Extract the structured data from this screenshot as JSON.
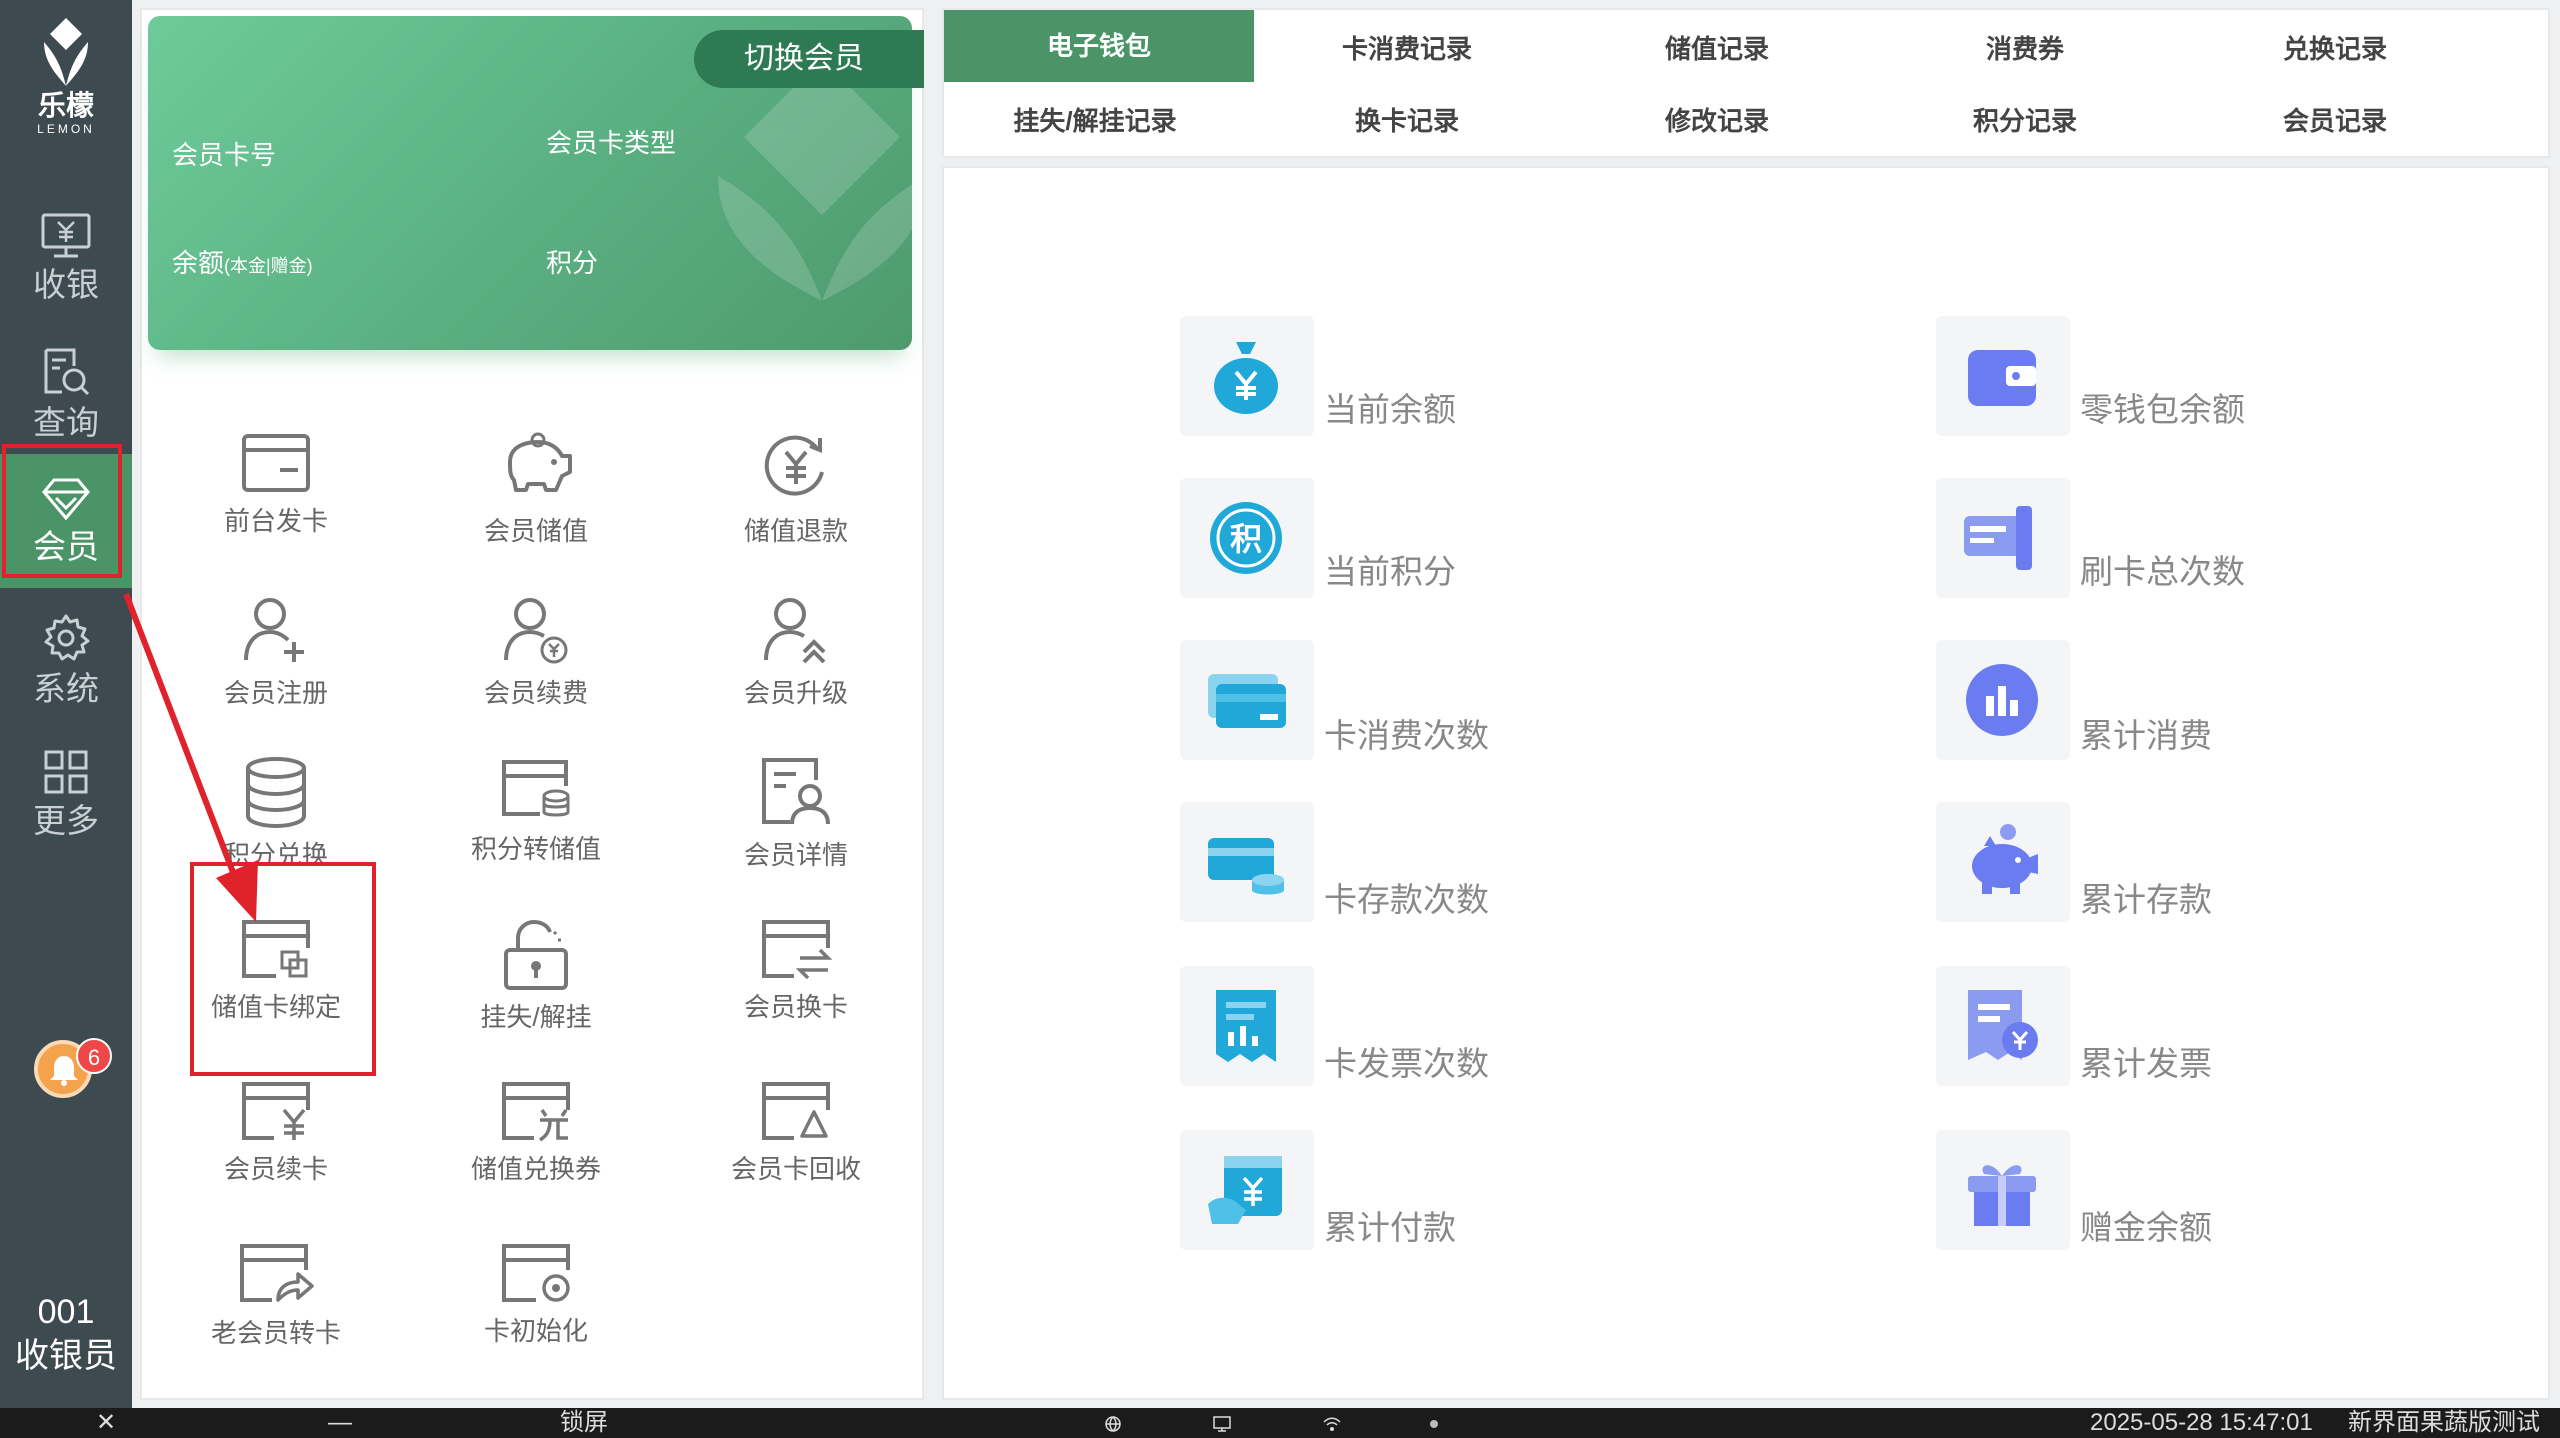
{
  "sidebar": {
    "logo_cn": "乐檬",
    "logo_en": "LEMON",
    "items": [
      {
        "label": "收银",
        "icon": "cashier-icon"
      },
      {
        "label": "查询",
        "icon": "search-doc-icon"
      },
      {
        "label": "会员",
        "icon": "diamond-icon"
      },
      {
        "label": "系统",
        "icon": "gear-icon"
      },
      {
        "label": "更多",
        "icon": "grid-icon"
      }
    ],
    "notification_count": "6",
    "user_id": "001",
    "user_role": "收银员"
  },
  "member_card": {
    "switch_label": "切换会员",
    "card_no_label": "会员卡号",
    "card_type_label": "会员卡类型",
    "balance_label": "余额",
    "balance_sub": "(本金|赠金)",
    "points_label": "积分"
  },
  "functions": [
    "前台发卡",
    "会员储值",
    "储值退款",
    "会员注册",
    "会员续费",
    "会员升级",
    "积分兑换",
    "积分转储值",
    "会员详情",
    "储值卡绑定",
    "挂失/解挂",
    "会员换卡",
    "会员续卡",
    "储值兑换券",
    "会员卡回收",
    "老会员转卡",
    "卡初始化"
  ],
  "tabs": [
    "电子钱包",
    "卡消费记录",
    "储值记录",
    "消费券",
    "兑换记录",
    "挂失/解挂记录",
    "换卡记录",
    "修改记录",
    "积分记录",
    "会员记录"
  ],
  "stats": [
    "当前余额",
    "零钱包余额",
    "当前积分",
    "刷卡总次数",
    "卡消费次数",
    "累计消费",
    "卡存款次数",
    "累计存款",
    "卡发票次数",
    "累计发票",
    "累计付款",
    "赠金余额"
  ],
  "taskbar": {
    "close": "✕",
    "minimize": "—",
    "lock": "锁屏",
    "datetime": "2025-05-28 15:47:01",
    "store": "新界面果蔬版测试"
  },
  "colors": {
    "accent": "#4a9468",
    "sidebar_bg": "#3d4a50",
    "highlight": "#e0222c"
  }
}
